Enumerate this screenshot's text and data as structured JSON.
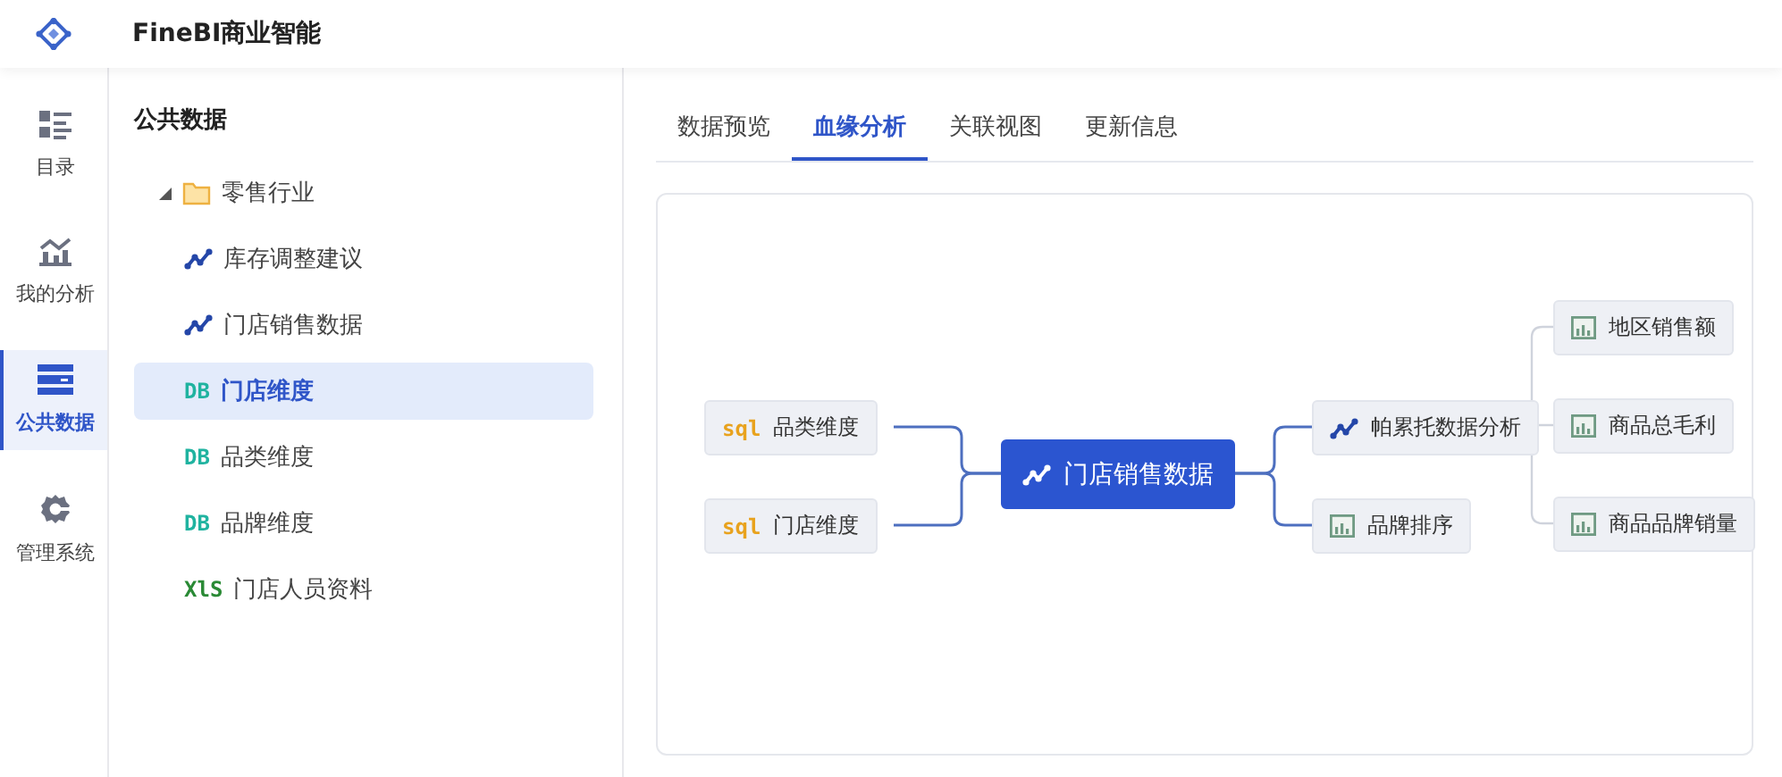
{
  "app": {
    "title": "FineBI商业智能"
  },
  "rail": [
    {
      "label": "目录",
      "kind": "catalog",
      "selected": false
    },
    {
      "label": "我的分析",
      "kind": "analysis",
      "selected": false
    },
    {
      "label": "公共数据",
      "kind": "data",
      "selected": true
    },
    {
      "label": "管理系统",
      "kind": "admin",
      "selected": false
    }
  ],
  "tree": {
    "title": "公共数据",
    "items": [
      {
        "label": "零售行业",
        "kind": "folder",
        "expanded": true,
        "selected": false,
        "children": [
          {
            "label": "库存调整建议",
            "kind": "analysis",
            "selected": false
          },
          {
            "label": "门店销售数据",
            "kind": "analysis",
            "selected": false
          },
          {
            "label": "门店维度",
            "kind": "table",
            "badge": "DB",
            "selected": true
          },
          {
            "label": "品类维度",
            "kind": "table",
            "badge": "DB",
            "selected": false
          },
          {
            "label": "品牌维度",
            "kind": "table",
            "badge": "DB",
            "selected": false
          },
          {
            "label": "门店人员资料",
            "kind": "excel",
            "badge": "XlS",
            "selected": false
          }
        ]
      }
    ]
  },
  "tabs": [
    {
      "label": "数据预览",
      "selected": false
    },
    {
      "label": "血缘分析",
      "selected": true
    },
    {
      "label": "关联视图",
      "selected": false
    },
    {
      "label": "更新信息",
      "selected": false
    }
  ],
  "lineage": {
    "sources": [
      {
        "label": "品类维度",
        "kind": "sql",
        "badge": "sql"
      },
      {
        "label": "门店维度",
        "kind": "sql",
        "badge": "sql"
      }
    ],
    "center": {
      "label": "门店销售数据",
      "kind": "analysis"
    },
    "outputs": [
      {
        "label": "帕累托数据分析",
        "kind": "analysis",
        "children": [
          {
            "label": "地区销售额",
            "kind": "chart"
          },
          {
            "label": "商品总毛利",
            "kind": "chart"
          },
          {
            "label": "商品品牌销量",
            "kind": "chart"
          }
        ]
      },
      {
        "label": "品牌排序",
        "kind": "chart"
      }
    ]
  }
}
